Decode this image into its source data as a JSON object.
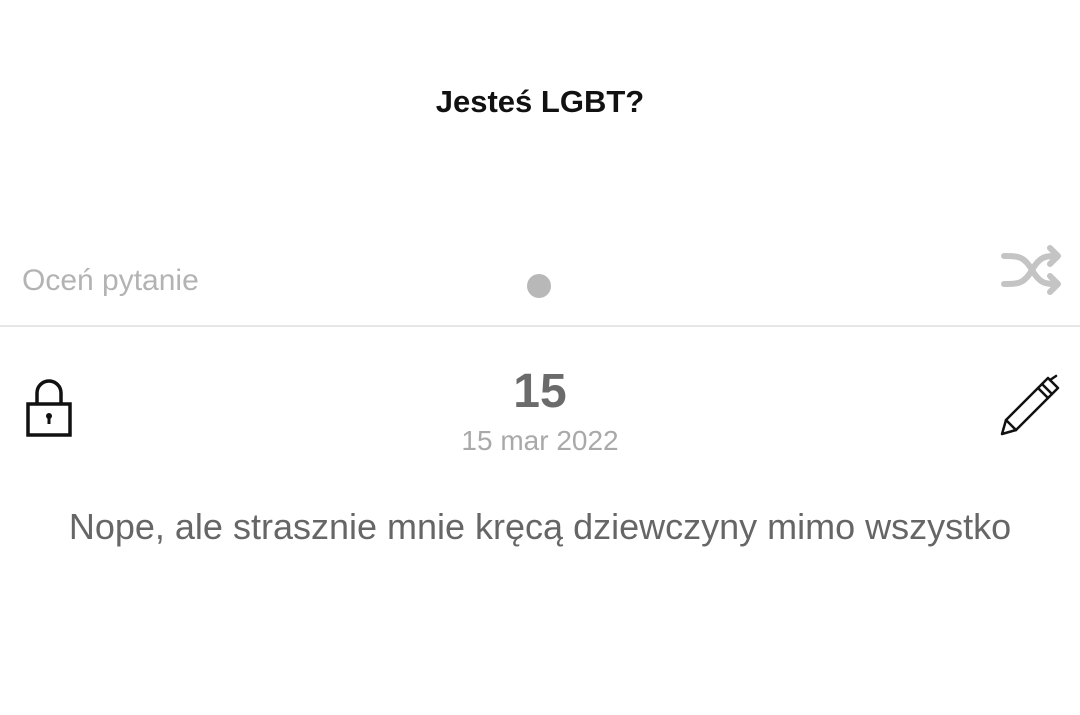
{
  "question": {
    "title": "Jesteś LGBT?"
  },
  "rating": {
    "label": "Oceń pytanie"
  },
  "icons": {
    "shuffle": "shuffle-icon",
    "lock": "lock-icon",
    "edit": "pencil-icon"
  },
  "answer": {
    "count": "15",
    "date": "15 mar 2022",
    "text": "Nope, ale strasznie mnie kręcą dziewczyny mimo wszystko"
  },
  "colors": {
    "background": "#ffffff",
    "title": "#111111",
    "muted": "#b3b3b3",
    "divider": "#e6e6e6",
    "body_text": "#666666"
  }
}
